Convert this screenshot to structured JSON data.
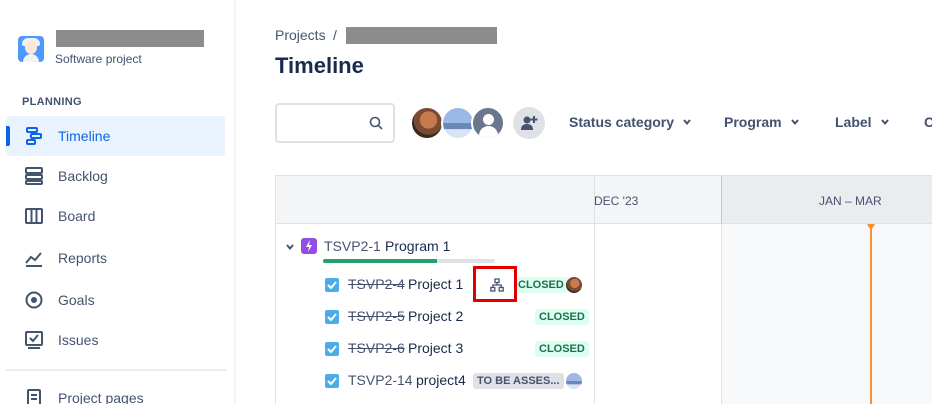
{
  "sidebar": {
    "project_type": "Software project",
    "section_label": "PLANNING",
    "items": [
      {
        "label": "Timeline",
        "icon": "timeline-icon",
        "active": true
      },
      {
        "label": "Backlog",
        "icon": "backlog-icon"
      },
      {
        "label": "Board",
        "icon": "board-icon"
      },
      {
        "label": "Reports",
        "icon": "reports-icon"
      },
      {
        "label": "Goals",
        "icon": "goals-icon"
      },
      {
        "label": "Issues",
        "icon": "issues-icon"
      },
      {
        "label": "Project pages",
        "icon": "pages-icon"
      }
    ]
  },
  "breadcrumb": {
    "root": "Projects",
    "separator": "/"
  },
  "page": {
    "title": "Timeline"
  },
  "toolbar": {
    "search_placeholder": "",
    "filters": [
      "Status category",
      "Program",
      "Label",
      "C"
    ]
  },
  "timeline": {
    "months": {
      "dec": "DEC '23",
      "quarter": "JAN – MAR"
    },
    "epic": {
      "key": "TSVP2-1",
      "summary": "Program 1",
      "progress": 0.66
    },
    "issues": [
      {
        "key": "TSVP2-4",
        "summary": "Project 1",
        "status": "CLOSED",
        "done": true
      },
      {
        "key": "TSVP2-5",
        "summary": "Project 2",
        "status": "CLOSED",
        "done": true
      },
      {
        "key": "TSVP2-6",
        "summary": "Project 3",
        "status": "CLOSED",
        "done": true
      },
      {
        "key": "TSVP2-14",
        "summary": "project4",
        "status": "TO BE ASSES...",
        "done": false
      }
    ]
  },
  "colors": {
    "accent": "#0c66e4",
    "today": "#f79233",
    "highlight": "#e00000"
  }
}
